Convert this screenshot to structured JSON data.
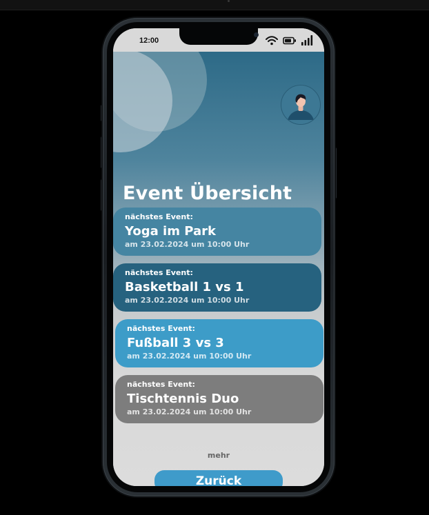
{
  "status_bar": {
    "time": "12:00"
  },
  "header": {
    "title": "Event Übersicht"
  },
  "events": [
    {
      "label": "nächstes Event:",
      "name": "Yoga im Park",
      "date": "am 23.02.2024 um 10:00 Uhr",
      "color": "#4585a2"
    },
    {
      "label": "nächstes Event:",
      "name": "Basketball 1 vs 1",
      "date": "am 23.02.2024 um 10:00 Uhr",
      "color": "#26627f"
    },
    {
      "label": "nächstes Event:",
      "name": "Fußball 3 vs 3",
      "date": "am 23.02.2024 um 10:00 Uhr",
      "color": "#3d9cc8"
    },
    {
      "label": "nächstes Event:",
      "name": "Tischtennis Duo",
      "date": "am 23.02.2024 um 10:00 Uhr",
      "color": "#7d7d7d"
    }
  ],
  "more_label": "mehr",
  "back_button": {
    "label": "Zurück",
    "color": "#3f9bca"
  },
  "icons": {
    "wifi": "wifi-icon",
    "battery": "battery-icon",
    "signal": "signal-icon",
    "avatar": "user-avatar-icon"
  }
}
